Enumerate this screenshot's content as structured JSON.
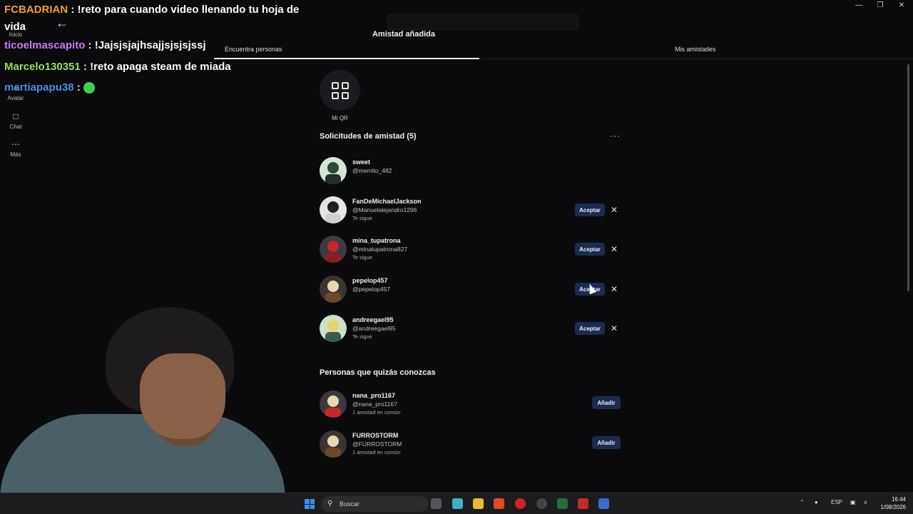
{
  "header": {
    "title": "Amistad añadida",
    "tabs": [
      {
        "label": "Encuentra personas"
      },
      {
        "label": "Mis amistades"
      }
    ]
  },
  "rail": {
    "items": [
      {
        "label": "Inicio"
      },
      {
        "label": "Avatar"
      },
      {
        "label": "Chat"
      },
      {
        "label": "Más"
      }
    ]
  },
  "qr": {
    "label": "Mi QR"
  },
  "requests": {
    "title": "Solicitudes de amistad (5)",
    "accept_label": "Aceptar",
    "items": [
      {
        "name": "sweet",
        "handle": "@memito_482",
        "note": ""
      },
      {
        "name": "FanDeMichaelJackson",
        "handle": "@Manuelalejandro1296",
        "note": "Te sigue"
      },
      {
        "name": "mina_tupatrona",
        "handle": "@minatupatrona827",
        "note": "Te sigue"
      },
      {
        "name": "pepelop457",
        "handle": "@pepelop457",
        "note": ""
      },
      {
        "name": "andreegael95",
        "handle": "@andreegael95",
        "note": "Te sigue"
      }
    ]
  },
  "suggestions": {
    "title": "Personas que quizás conozcas",
    "add_label": "Añadir",
    "items": [
      {
        "name": "nana_pro1167",
        "handle": "@nana_pro1167",
        "note": "1 amistad en común"
      },
      {
        "name": "FURROSTORM",
        "handle": "@FURROSTORM",
        "note": "1 amistad en común"
      }
    ]
  },
  "chat_overlay": [
    {
      "user": "FCBADRIAN",
      "message": " : !reto para cuando video llenando tu hoja de vida",
      "color": "#f0a030"
    },
    {
      "user": "ticoelmascapito",
      "message": " : !Jajsjsjajhsajjsjsjsjssj",
      "color": "#c77dff"
    },
    {
      "user": "Marcelo130351",
      "message": " : !reto apaga steam de miada",
      "color": "#9be15d"
    },
    {
      "user": "martiapapu38",
      "message": " : ",
      "color": "#4a90e2"
    }
  ],
  "taskbar": {
    "search_placeholder": "Buscar",
    "language": "ESP",
    "time": "16:44",
    "date": "1/08/2026"
  },
  "colors": {
    "background": "#0b0b0d",
    "button_bg": "#1c2b4f",
    "accent_blue": "#3b8ef0"
  }
}
